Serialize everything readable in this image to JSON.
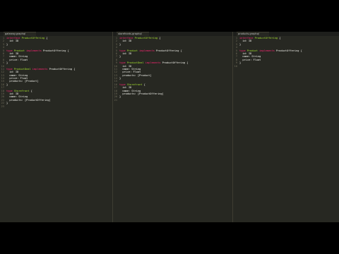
{
  "panes": [
    {
      "tab": "gateway.graphql",
      "lines": [
        [
          {
            "t": "interface ",
            "c": "kw"
          },
          {
            "t": "ProductOffering",
            "c": "nm"
          },
          {
            "t": " {",
            "c": ""
          }
        ],
        [
          {
            "t": "  id: ID",
            "c": ""
          }
        ],
        [
          {
            "t": "}",
            "c": ""
          }
        ],
        [],
        [
          {
            "t": "type ",
            "c": "kw"
          },
          {
            "t": "Product",
            "c": "nm"
          },
          {
            "t": " implements ",
            "c": "kw"
          },
          {
            "t": "ProductOffering",
            "c": ""
          },
          {
            "t": " {",
            "c": ""
          }
        ],
        [
          {
            "t": "  id: ID",
            "c": ""
          }
        ],
        [
          {
            "t": "  name: String",
            "c": ""
          }
        ],
        [
          {
            "t": "  price: Float",
            "c": ""
          }
        ],
        [
          {
            "t": "}",
            "c": ""
          }
        ],
        [],
        [
          {
            "t": "type ",
            "c": "kw"
          },
          {
            "t": "ProductDeal",
            "c": "nm"
          },
          {
            "t": " implements ",
            "c": "kw"
          },
          {
            "t": "ProductOffering",
            "c": ""
          },
          {
            "t": " {",
            "c": ""
          }
        ],
        [
          {
            "t": "  id: ID",
            "c": ""
          }
        ],
        [
          {
            "t": "  name: String",
            "c": ""
          }
        ],
        [
          {
            "t": "  price: Float",
            "c": ""
          }
        ],
        [
          {
            "t": "  products: [Product]",
            "c": ""
          }
        ],
        [
          {
            "t": "}",
            "c": ""
          }
        ],
        [],
        [
          {
            "t": "type ",
            "c": "kw"
          },
          {
            "t": "Storefront",
            "c": "nm"
          },
          {
            "t": " {",
            "c": ""
          }
        ],
        [
          {
            "t": "  id: ID",
            "c": ""
          }
        ],
        [
          {
            "t": "  name: String",
            "c": ""
          }
        ],
        [
          {
            "t": "  products: [ProductOffering]",
            "c": ""
          }
        ],
        [
          {
            "t": "}",
            "c": ""
          }
        ],
        []
      ]
    },
    {
      "tab": "storefronts.graphql",
      "lines": [
        [
          {
            "t": "interface ",
            "c": "kw"
          },
          {
            "t": "ProductOffering",
            "c": "nm"
          },
          {
            "t": " {",
            "c": ""
          }
        ],
        [
          {
            "t": "  id: ID",
            "c": ""
          }
        ],
        [
          {
            "t": "}",
            "c": ""
          }
        ],
        [],
        [
          {
            "t": "type ",
            "c": "kw"
          },
          {
            "t": "Product",
            "c": "nm"
          },
          {
            "t": " implements ",
            "c": "kw"
          },
          {
            "t": "ProductOffering",
            "c": ""
          },
          {
            "t": " {",
            "c": ""
          }
        ],
        [
          {
            "t": "  id: ID",
            "c": ""
          }
        ],
        [
          {
            "t": "}",
            "c": ""
          }
        ],
        [],
        [
          {
            "t": "type ",
            "c": "kw"
          },
          {
            "t": "ProductDeal",
            "c": "nm"
          },
          {
            "t": " implements ",
            "c": "kw"
          },
          {
            "t": "ProductOffering",
            "c": ""
          },
          {
            "t": " {",
            "c": ""
          }
        ],
        [
          {
            "t": "  id: ID",
            "c": ""
          }
        ],
        [
          {
            "t": "  name: String",
            "c": ""
          }
        ],
        [
          {
            "t": "  price: Float",
            "c": ""
          }
        ],
        [
          {
            "t": "  products: [Product]",
            "c": ""
          }
        ],
        [
          {
            "t": "}",
            "c": ""
          }
        ],
        [],
        [
          {
            "t": "type ",
            "c": "kw"
          },
          {
            "t": "Storefront",
            "c": "nm"
          },
          {
            "t": " {",
            "c": ""
          }
        ],
        [
          {
            "t": "  id: ID",
            "c": ""
          }
        ],
        [
          {
            "t": "  name: String",
            "c": ""
          }
        ],
        [
          {
            "t": "  products: [ProductOffering]",
            "c": ""
          }
        ],
        [
          {
            "t": "}",
            "c": ""
          }
        ],
        []
      ]
    },
    {
      "tab": "products.graphql",
      "lines": [
        [
          {
            "t": "interface ",
            "c": "kw"
          },
          {
            "t": "ProductOffering",
            "c": "nm"
          },
          {
            "t": " {",
            "c": ""
          }
        ],
        [
          {
            "t": "  id: ID",
            "c": ""
          }
        ],
        [
          {
            "t": "}",
            "c": ""
          }
        ],
        [],
        [
          {
            "t": "type ",
            "c": "kw"
          },
          {
            "t": "Product",
            "c": "nm"
          },
          {
            "t": " implements ",
            "c": "kw"
          },
          {
            "t": "ProductOffering",
            "c": ""
          },
          {
            "t": " {",
            "c": ""
          }
        ],
        [
          {
            "t": "  id: ID",
            "c": ""
          }
        ],
        [
          {
            "t": "  name: String",
            "c": ""
          }
        ],
        [
          {
            "t": "  price: Float",
            "c": ""
          }
        ],
        [
          {
            "t": "}",
            "c": ""
          }
        ],
        []
      ]
    }
  ],
  "colors": {
    "background": "#272822",
    "keyword": "#f92672",
    "name": "#a6e22e",
    "text": "#f8f8f2",
    "line_number": "#75715e"
  }
}
